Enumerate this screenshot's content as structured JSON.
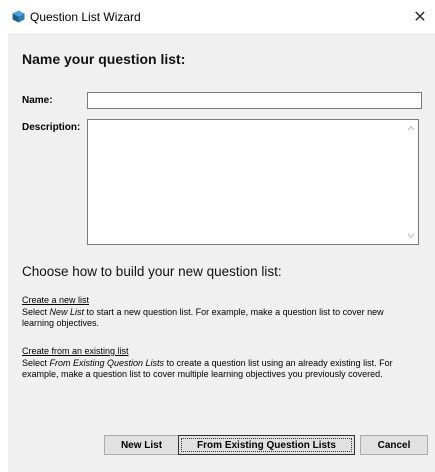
{
  "window": {
    "title": "Question List Wizard"
  },
  "heading": "Name your question list:",
  "form": {
    "name_label": "Name:",
    "name_value": "",
    "description_label": "Description:",
    "description_value": ""
  },
  "section_title": "Choose how to build your new question list:",
  "options": [
    {
      "link": "Create a new list",
      "desc_pre": "Select ",
      "desc_em": "New List",
      "desc_post": " to start a new question list. For example, make a question list to cover new learning objectives."
    },
    {
      "link": "Create from an existing list",
      "desc_pre": "Select ",
      "desc_em": "From Existing Question Lists",
      "desc_post": " to create a question list using an already existing list. For example, make a question list to cover multiple learning objectives you previously covered."
    }
  ],
  "buttons": {
    "new_list": "New List",
    "from_existing": "From Existing Question Lists",
    "cancel": "Cancel"
  },
  "icons": {
    "app": "cube-icon",
    "close": "close-icon"
  }
}
